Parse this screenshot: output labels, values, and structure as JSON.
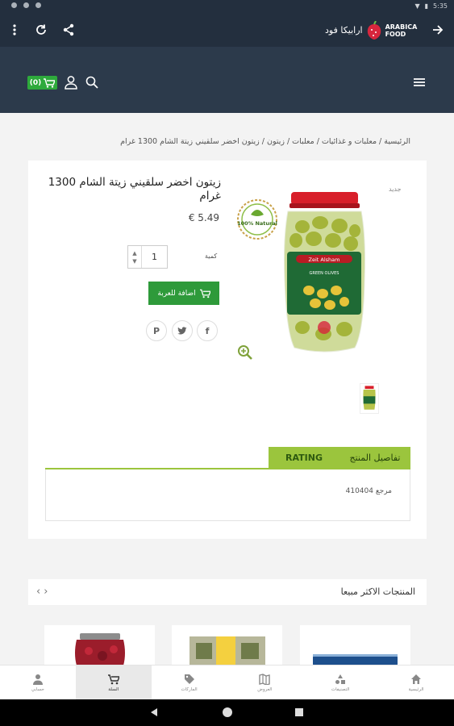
{
  "status_bar": {
    "time": "5:35"
  },
  "topbar": {
    "logo_ar": "ارابيكا فود",
    "logo_en_1": "ARABICA",
    "logo_en_2": "FOOD"
  },
  "header": {
    "cart_count": "(0)"
  },
  "breadcrumb": "الرئيسية / معلبات و غذائيات / معلبات / زيتون / زيتون اخضر سلقيني زيتة الشام 1300 غرام",
  "product": {
    "label_new": "جديد",
    "title": "زيتون اخضر سلقيني زيتة الشام 1300 غرام",
    "price": "€ 5.49",
    "qty_label": "كمية",
    "qty_value": "1",
    "add_to_cart": "اضافة للعربة",
    "badge_text": "100% Natural",
    "jar_brand": "Zeit Alsham",
    "jar_type": "GREEN OLIVES"
  },
  "tabs": {
    "details": "تفاصيل المنتج",
    "rating": "RATING"
  },
  "details": {
    "reference": "مرجع 410404"
  },
  "best_sellers": {
    "title": "المنتجات الاكثر مبيعا"
  },
  "bottom_nav": [
    {
      "label": "الرئيسية",
      "icon": "home-icon"
    },
    {
      "label": "التصنيفات",
      "icon": "categories-icon"
    },
    {
      "label": "العروض",
      "icon": "offers-icon"
    },
    {
      "label": "الماركات",
      "icon": "brands-icon"
    },
    {
      "label": "السلة",
      "icon": "cart-icon"
    },
    {
      "label": "حسابي",
      "icon": "account-icon"
    }
  ],
  "colors": {
    "header_dark": "#232f3e",
    "header": "#2c3a4b",
    "accent_green": "#2e9a3a",
    "tab_green": "#9bc53d"
  }
}
